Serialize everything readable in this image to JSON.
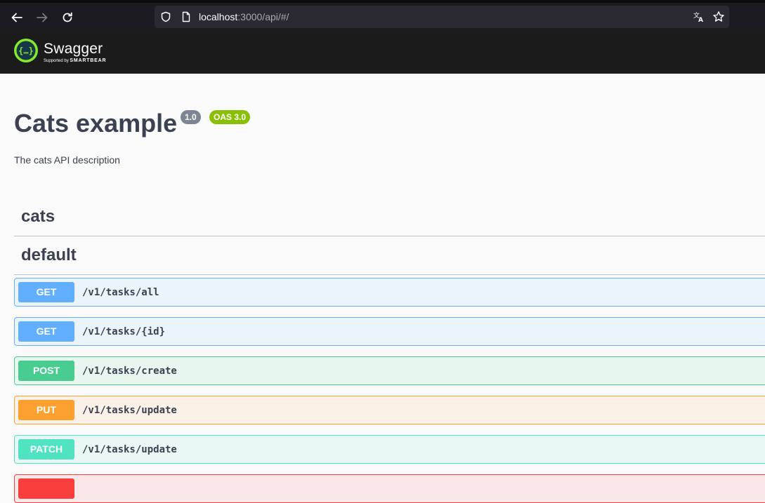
{
  "browser": {
    "url_host": "localhost",
    "url_rest": ":3000/api/#/"
  },
  "topbar": {
    "logo_word": "Swagger",
    "logo_sub_prefix": "Supported by",
    "logo_sub_brand": "SMARTBEAR"
  },
  "info": {
    "title": "Cats example",
    "version": "1.0",
    "oas": "OAS 3.0",
    "description": "The cats API description"
  },
  "tags": [
    {
      "name": "cats"
    },
    {
      "name": "default"
    }
  ],
  "operations": [
    {
      "method": "GET",
      "path": "/v1/tasks/all"
    },
    {
      "method": "GET",
      "path": "/v1/tasks/{id}"
    },
    {
      "method": "POST",
      "path": "/v1/tasks/create"
    },
    {
      "method": "PUT",
      "path": "/v1/tasks/update"
    },
    {
      "method": "PATCH",
      "path": "/v1/tasks/update"
    },
    {
      "method": "",
      "path": ""
    }
  ],
  "colors": {
    "get": "#61affe",
    "post": "#49cc90",
    "put": "#fca130",
    "patch": "#50e3c2",
    "delete": "#f93e3e",
    "swagger_green": "#85ea2d",
    "topbar": "#1b1b1b"
  },
  "icons": {
    "back": "arrow-left-icon",
    "forward": "arrow-right-icon",
    "reload": "reload-icon",
    "shield": "shield-icon",
    "page": "page-icon",
    "translate": "translate-icon",
    "bookmark": "star-icon"
  }
}
